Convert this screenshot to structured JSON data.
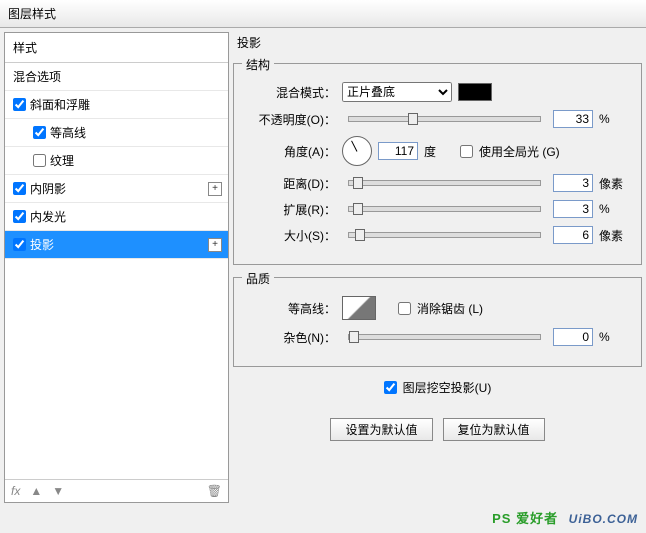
{
  "window": {
    "title": "图层样式"
  },
  "left": {
    "header": "样式",
    "items": [
      {
        "label": "混合选项",
        "checked": null,
        "sub": false,
        "plus": false
      },
      {
        "label": "斜面和浮雕",
        "checked": true,
        "sub": false,
        "plus": false
      },
      {
        "label": "等高线",
        "checked": true,
        "sub": true,
        "plus": false
      },
      {
        "label": "纹理",
        "checked": false,
        "sub": true,
        "plus": false
      },
      {
        "label": "内阴影",
        "checked": true,
        "sub": false,
        "plus": true
      },
      {
        "label": "内发光",
        "checked": true,
        "sub": false,
        "plus": false
      },
      {
        "label": "投影",
        "checked": true,
        "sub": false,
        "plus": true,
        "selected": true
      }
    ],
    "fx": "fx"
  },
  "panel": {
    "title": "投影",
    "structure": {
      "title": "结构",
      "blend_label": "混合模式：",
      "blend_value": "正片叠底",
      "opacity_label": "不透明度(O)：",
      "opacity_value": "33",
      "opacity_unit": "%",
      "angle_label": "角度(A)：",
      "angle_value": "117",
      "angle_unit": "度",
      "global_light": "使用全局光 (G)",
      "distance_label": "距离(D)：",
      "distance_value": "3",
      "distance_unit": "像素",
      "spread_label": "扩展(R)：",
      "spread_value": "3",
      "spread_unit": "%",
      "size_label": "大小(S)：",
      "size_value": "6",
      "size_unit": "像素"
    },
    "quality": {
      "title": "品质",
      "contour_label": "等高线：",
      "antialias": "消除锯齿 (L)",
      "noise_label": "杂色(N)：",
      "noise_value": "0",
      "noise_unit": "%"
    },
    "knockout": "图层挖空投影(U)",
    "btn_default": "设置为默认值",
    "btn_reset": "复位为默认值"
  },
  "watermark": {
    "tag": "PS 爱好者",
    "url": "UiBO.COM"
  }
}
